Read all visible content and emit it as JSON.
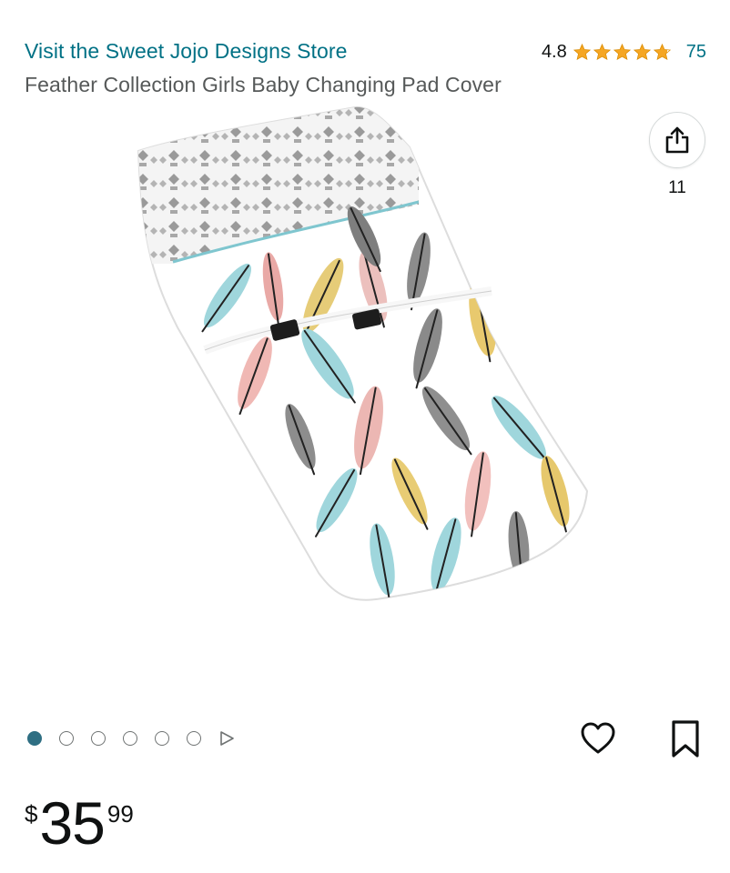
{
  "header": {
    "store_link": "Visit the Sweet Jojo Designs Store",
    "rating_value": "4.8",
    "rating_stars": 4.8,
    "rating_count": "75",
    "title": "Feather Collection Girls Baby Changing Pad Cover"
  },
  "share": {
    "count": "11",
    "icon": "share-icon"
  },
  "gallery": {
    "image_count": 6,
    "active_index": 0
  },
  "actions": {
    "favorite_icon": "heart-icon",
    "save_icon": "bookmark-icon"
  },
  "price": {
    "symbol": "$",
    "whole": "35",
    "fraction": "99"
  },
  "colors": {
    "link": "#007185",
    "star": "#f5a623",
    "active_dot": "#2f6f83"
  }
}
